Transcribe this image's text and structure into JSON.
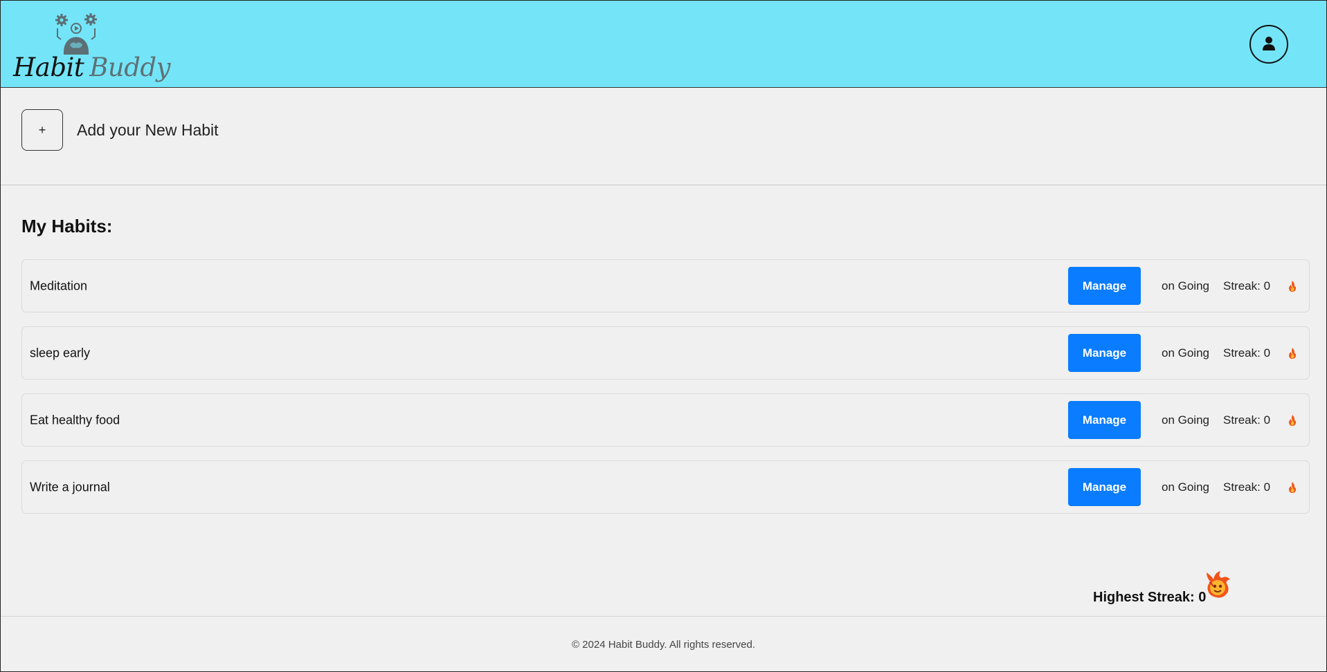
{
  "header": {
    "brand_word1": "Habit",
    "brand_word2": "Buddy",
    "logo_icon": "brain-gears-icon",
    "profile_icon": "user-icon",
    "bg_color": "#74e5f8"
  },
  "add_habit": {
    "button_label": "+",
    "label": "Add your New Habit"
  },
  "habits_section": {
    "title": "My Habits:",
    "items": [
      {
        "name": "Meditation",
        "manage_label": "Manage",
        "status": "on Going",
        "streak": "Streak: 0"
      },
      {
        "name": "sleep early",
        "manage_label": "Manage",
        "status": "on Going",
        "streak": "Streak: 0"
      },
      {
        "name": "Eat healthy food",
        "manage_label": "Manage",
        "status": "on Going",
        "streak": "Streak: 0"
      },
      {
        "name": "Write a journal",
        "manage_label": "Manage",
        "status": "on Going",
        "streak": "Streak: 0"
      }
    ],
    "accent_color": "#0a7cff"
  },
  "summary": {
    "highest_streak": "Highest Streak: 0",
    "icon": "flaming-face-icon"
  },
  "footer": {
    "text": "© 2024 Habit Buddy. All rights reserved."
  }
}
